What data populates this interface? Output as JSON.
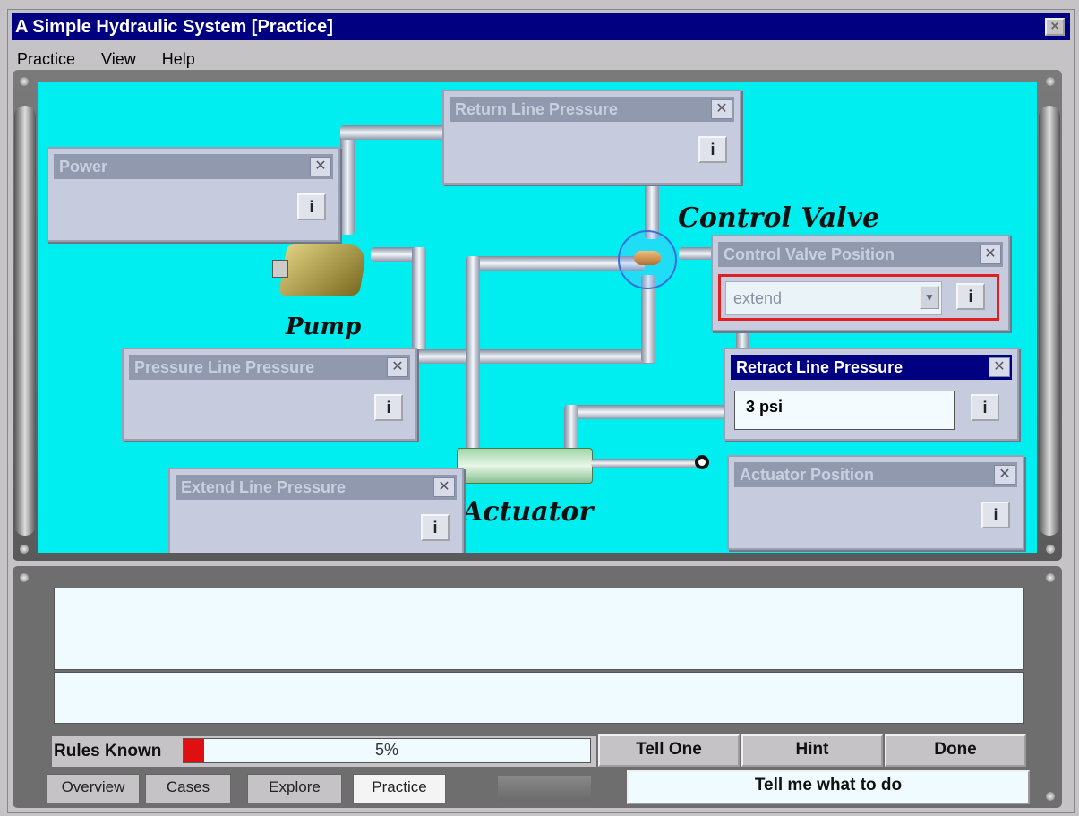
{
  "window": {
    "title": "A Simple Hydraulic System [Practice]",
    "close_label": "×"
  },
  "menu": [
    "Practice",
    "View",
    "Help"
  ],
  "diagram": {
    "labels": {
      "control_valve": "Control Valve",
      "pump": "Pump",
      "actuator": "Actuator"
    },
    "panels": {
      "return_line_pressure": {
        "title": "Return Line Pressure",
        "info": "i"
      },
      "power": {
        "title": "Power",
        "info": "i"
      },
      "control_valve_position": {
        "title": "Control Valve Position",
        "selected": "extend",
        "info": "i"
      },
      "pressure_line_pressure": {
        "title": "Pressure Line Pressure",
        "info": "i"
      },
      "retract_line_pressure": {
        "title": "Retract Line Pressure",
        "value": "3 psi",
        "info": "i"
      },
      "extend_line_pressure": {
        "title": "Extend Line Pressure",
        "info": "i"
      },
      "actuator_position": {
        "title": "Actuator Position",
        "info": "i"
      }
    }
  },
  "progress": {
    "label": "Rules Known",
    "value_text": "5%",
    "fraction": 0.05
  },
  "buttons": {
    "tell_one": "Tell One",
    "hint": "Hint",
    "done": "Done",
    "tell_me": "Tell me what to do"
  },
  "tabs": [
    "Overview",
    "Cases",
    "Explore",
    "Practice"
  ],
  "colors": {
    "canvas": "#00eef0",
    "titlebar": "#000080",
    "progress_fill": "#e01010",
    "highlight": "#e02020"
  }
}
